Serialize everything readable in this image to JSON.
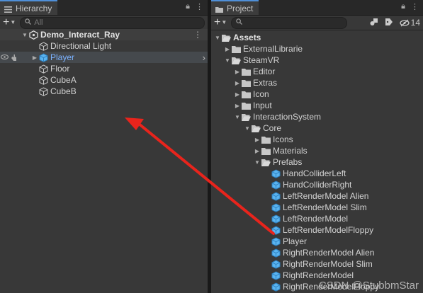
{
  "hierarchy": {
    "tab_label": "Hierarchy",
    "search_placeholder": "All",
    "scene_name": "Demo_Interact_Ray",
    "items": [
      {
        "label": "Directional Light",
        "selected": false
      },
      {
        "label": "Player",
        "selected": true
      },
      {
        "label": "Floor",
        "selected": false
      },
      {
        "label": "CubeA",
        "selected": false
      },
      {
        "label": "CubeB",
        "selected": false
      }
    ]
  },
  "project": {
    "tab_label": "Project",
    "search_placeholder": "",
    "hidden_count": "14",
    "tree": [
      {
        "label": "Assets",
        "type": "folder",
        "expanded": true,
        "bold": true
      },
      {
        "label": "ExternalLibrarie",
        "type": "folder",
        "expanded": false
      },
      {
        "label": "SteamVR",
        "type": "folder",
        "expanded": true
      },
      {
        "label": "Editor",
        "type": "folder",
        "expanded": false
      },
      {
        "label": "Extras",
        "type": "folder",
        "expanded": false
      },
      {
        "label": "Icon",
        "type": "folder",
        "expanded": false
      },
      {
        "label": "Input",
        "type": "folder",
        "expanded": false
      },
      {
        "label": "InteractionSystem",
        "type": "folder",
        "expanded": true
      },
      {
        "label": "Core",
        "type": "folder",
        "expanded": true
      },
      {
        "label": "Icons",
        "type": "folder",
        "expanded": false
      },
      {
        "label": "Materials",
        "type": "folder",
        "expanded": false
      },
      {
        "label": "Prefabs",
        "type": "folder",
        "expanded": true
      },
      {
        "label": "HandColliderLeft",
        "type": "prefab"
      },
      {
        "label": "HandColliderRight",
        "type": "prefab"
      },
      {
        "label": "LeftRenderModel Alien",
        "type": "prefab"
      },
      {
        "label": "LeftRenderModel Slim",
        "type": "prefab"
      },
      {
        "label": "LeftRenderModel",
        "type": "prefab"
      },
      {
        "label": "LeftRenderModelFloppy",
        "type": "prefab"
      },
      {
        "label": "Player",
        "type": "prefab"
      },
      {
        "label": "RightRenderModel Alien",
        "type": "prefab"
      },
      {
        "label": "RightRenderModel Slim",
        "type": "prefab"
      },
      {
        "label": "RightRenderModel",
        "type": "prefab"
      },
      {
        "label": "RightRenderModelFloppy",
        "type": "prefab"
      }
    ]
  },
  "watermark": "CSDN @StubbmStar",
  "colors": {
    "selection_text": "#7bb2ff",
    "prefab_blue": "#5ab4f0",
    "arrow_red": "#e8241c",
    "tab_accent": "#4f8fd8"
  }
}
